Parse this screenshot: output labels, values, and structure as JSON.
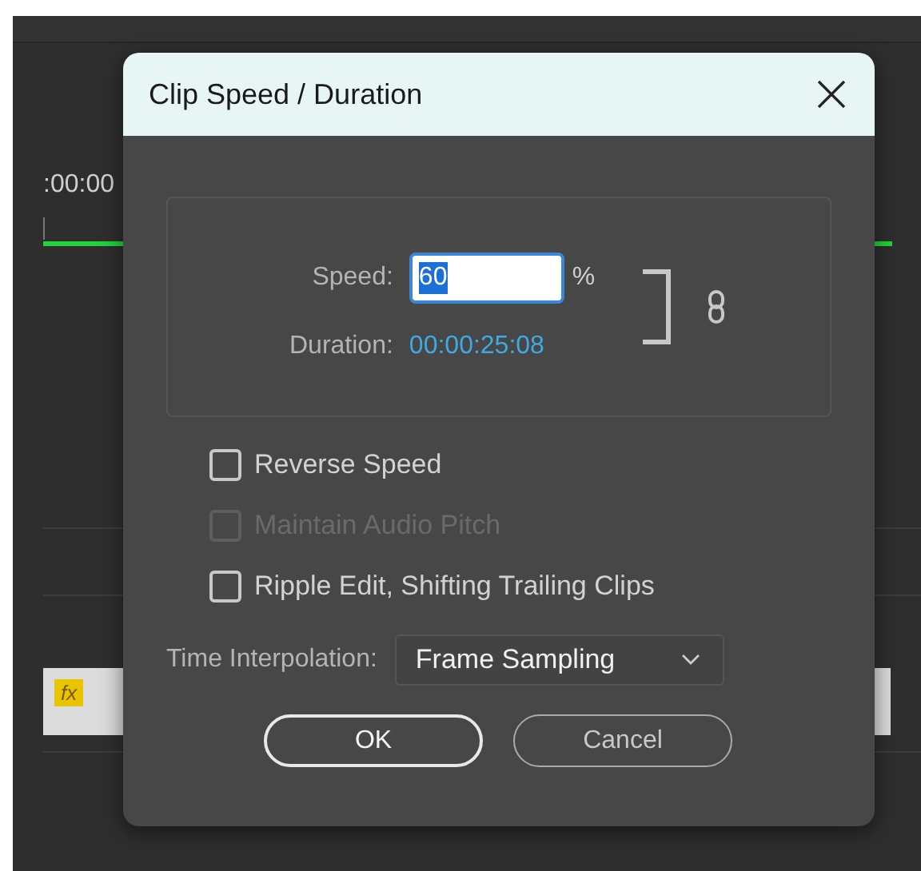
{
  "background": {
    "timecode": ":00:00",
    "clip_badge": "fx"
  },
  "dialog": {
    "title": "Clip Speed / Duration",
    "speed": {
      "label": "Speed:",
      "value": "60",
      "unit": "%"
    },
    "duration": {
      "label": "Duration:",
      "value": "00:00:25:08"
    },
    "options": [
      {
        "label": "Reverse Speed",
        "checked": false,
        "disabled": false
      },
      {
        "label": "Maintain Audio Pitch",
        "checked": false,
        "disabled": true
      },
      {
        "label": "Ripple Edit, Shifting Trailing Clips",
        "checked": false,
        "disabled": false
      }
    ],
    "interpolation": {
      "label": "Time Interpolation:",
      "value": "Frame Sampling"
    },
    "buttons": [
      {
        "label": "OK",
        "kind": "primary"
      },
      {
        "label": "Cancel",
        "kind": "secondary"
      }
    ]
  }
}
